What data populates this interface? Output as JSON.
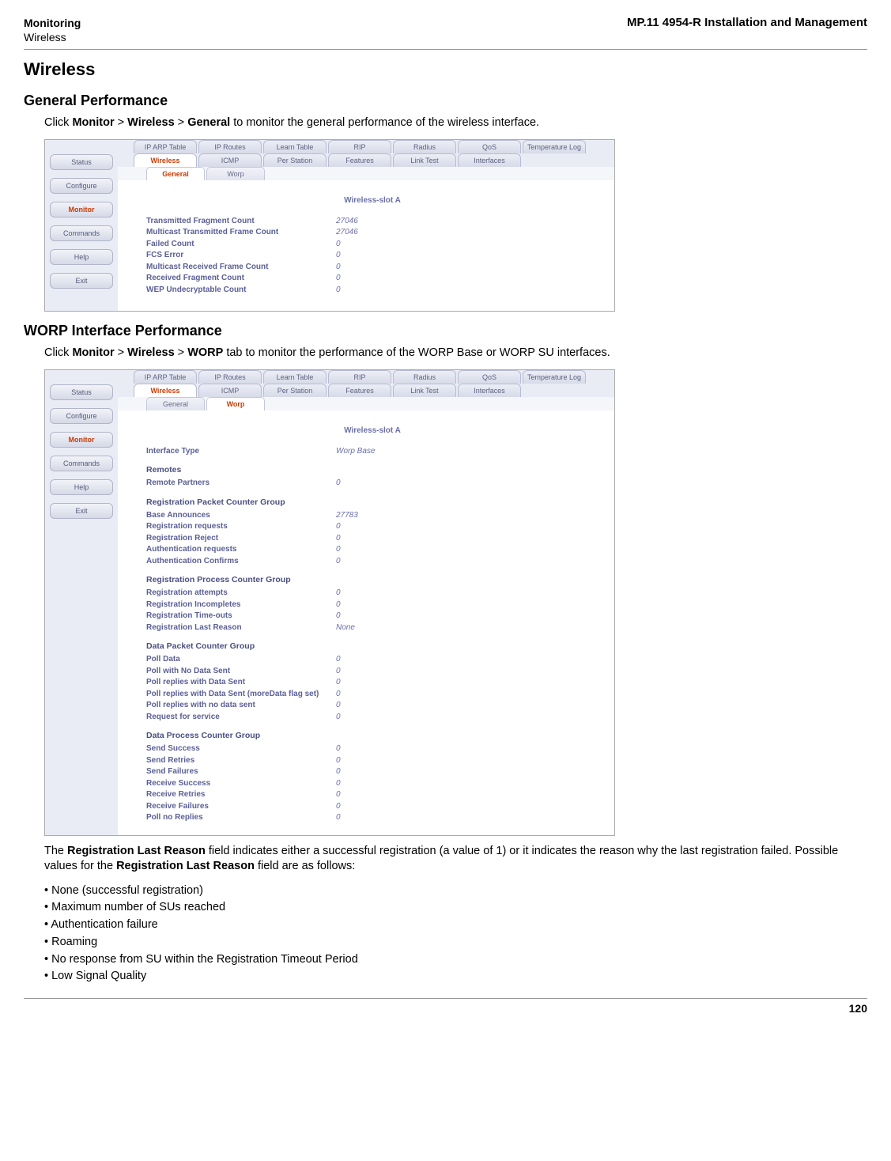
{
  "header": {
    "left_bold": "Monitoring",
    "left_plain": "Wireless",
    "right": "MP.11 4954-R Installation and Management"
  },
  "section_title": "Wireless",
  "general_perf": {
    "heading": "General Performance",
    "intro_pre": "Click ",
    "intro_b1": "Monitor",
    "intro_gt1": " > ",
    "intro_b2": "Wireless",
    "intro_gt2": " > ",
    "intro_b3": "General",
    "intro_post": " to monitor the general performance of the wireless interface."
  },
  "worp_perf": {
    "heading": "WORP Interface Performance",
    "intro_pre": "Click ",
    "intro_b1": "Monitor",
    "intro_gt1": " > ",
    "intro_b2": "Wireless",
    "intro_gt2": " > ",
    "intro_b3": "WORP",
    "intro_post": " tab to monitor the performance of the WORP Base or WORP SU interfaces."
  },
  "sidebar_buttons": [
    "Status",
    "Configure",
    "Monitor",
    "Commands",
    "Help",
    "Exit"
  ],
  "top_tabs": [
    "IP ARP Table",
    "IP Routes",
    "Learn Table",
    "RIP",
    "Radius",
    "QoS",
    "Temperature Log"
  ],
  "second_tabs": [
    "Wireless",
    "ICMP",
    "Per Station",
    "Features",
    "Link Test",
    "Interfaces"
  ],
  "sub_tabs_general": [
    "General",
    "Worp"
  ],
  "s1": {
    "slot": "Wireless-slot A",
    "rows": [
      {
        "lbl": "Transmitted Fragment Count",
        "val": "27046"
      },
      {
        "lbl": "Multicast Transmitted Frame Count",
        "val": "27046"
      },
      {
        "lbl": "Failed Count",
        "val": "0"
      },
      {
        "lbl": "FCS Error",
        "val": "0"
      },
      {
        "lbl": "Multicast Received Frame Count",
        "val": "0"
      },
      {
        "lbl": "Received Fragment Count",
        "val": "0"
      },
      {
        "lbl": "WEP Undecryptable Count",
        "val": "0"
      }
    ]
  },
  "s2": {
    "slot": "Wireless-slot A",
    "iface_type_lbl": "Interface Type",
    "iface_type_val": "Worp Base",
    "g_remotes": "Remotes",
    "remotes_rows": [
      {
        "lbl": "Remote Partners",
        "val": "0"
      }
    ],
    "g_reg_pkt": "Registration Packet Counter Group",
    "reg_pkt_rows": [
      {
        "lbl": "Base Announces",
        "val": "27783"
      },
      {
        "lbl": "Registration requests",
        "val": "0"
      },
      {
        "lbl": "Registration Reject",
        "val": "0"
      },
      {
        "lbl": "Authentication requests",
        "val": "0"
      },
      {
        "lbl": "Authentication Confirms",
        "val": "0"
      }
    ],
    "g_reg_proc": "Registration Process Counter Group",
    "reg_proc_rows": [
      {
        "lbl": "Registration attempts",
        "val": "0"
      },
      {
        "lbl": "Registration Incompletes",
        "val": "0"
      },
      {
        "lbl": "Registration Time-outs",
        "val": "0"
      },
      {
        "lbl": "Registration Last Reason",
        "val": "None"
      }
    ],
    "g_data_pkt": "Data Packet Counter Group",
    "data_pkt_rows": [
      {
        "lbl": "Poll Data",
        "val": "0"
      },
      {
        "lbl": "Poll with No Data Sent",
        "val": "0"
      },
      {
        "lbl": "Poll replies with Data Sent",
        "val": "0"
      },
      {
        "lbl": "Poll replies with Data Sent (moreData flag set)",
        "val": "0"
      },
      {
        "lbl": "Poll replies with no data sent",
        "val": "0"
      },
      {
        "lbl": "Request for service",
        "val": "0"
      }
    ],
    "g_data_proc": "Data Process Counter Group",
    "data_proc_rows": [
      {
        "lbl": "Send Success",
        "val": "0"
      },
      {
        "lbl": "Send Retries",
        "val": "0"
      },
      {
        "lbl": "Send Failures",
        "val": "0"
      },
      {
        "lbl": "Receive Success",
        "val": "0"
      },
      {
        "lbl": "Receive Retries",
        "val": "0"
      },
      {
        "lbl": "Receive Failures",
        "val": "0"
      },
      {
        "lbl": "Poll no Replies",
        "val": "0"
      }
    ]
  },
  "reason_para_pre": "The ",
  "reason_field": "Registration Last Reason",
  "reason_para_mid": " field indicates either a successful registration (a value of 1) or it indicates the reason why the last registration failed. Possible values for the ",
  "reason_para_post": " field are as follows:",
  "reason_list": [
    "None (successful registration)",
    "Maximum number of SUs reached",
    "Authentication failure",
    "Roaming",
    "No response from SU within the Registration Timeout Period",
    "Low Signal Quality"
  ],
  "page_number": "120"
}
